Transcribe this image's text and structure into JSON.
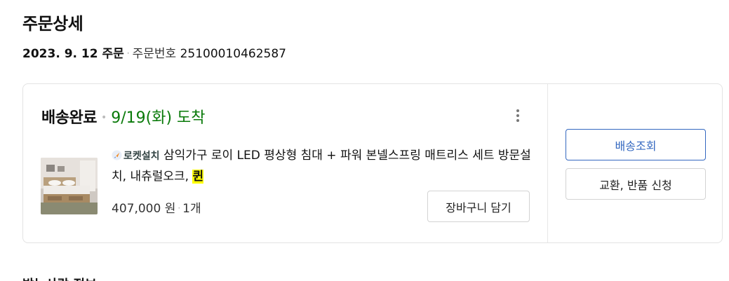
{
  "page": {
    "title": "주문상세",
    "order_date_label": "2023. 9. 12 주문",
    "order_number_label": "주문번호",
    "order_number": "25100010462587",
    "next_section_title": "받는사람 정보"
  },
  "order_card": {
    "status": "배송완료",
    "arrival": "9/19(화) 도착",
    "product": {
      "badge": "로켓설치",
      "name_part1": "삼익가구 로이 LED 평상형 침대 + 파워 본넬스프링 매트리스 세트 방문설치, 내츄럴오크, ",
      "name_highlight": "퀸",
      "price": "407,000 원",
      "quantity": "1개"
    },
    "add_to_cart_label": "장바구니 담기",
    "track_label": "배송조회",
    "return_label": "교환, 반품 신청"
  },
  "colors": {
    "arrival_green": "#0a7a0a",
    "track_blue": "#3468c0",
    "highlight_yellow": "#ffff00"
  },
  "icons": {
    "more": "more-vertical-icon",
    "rocket": "rocket-install-icon"
  }
}
